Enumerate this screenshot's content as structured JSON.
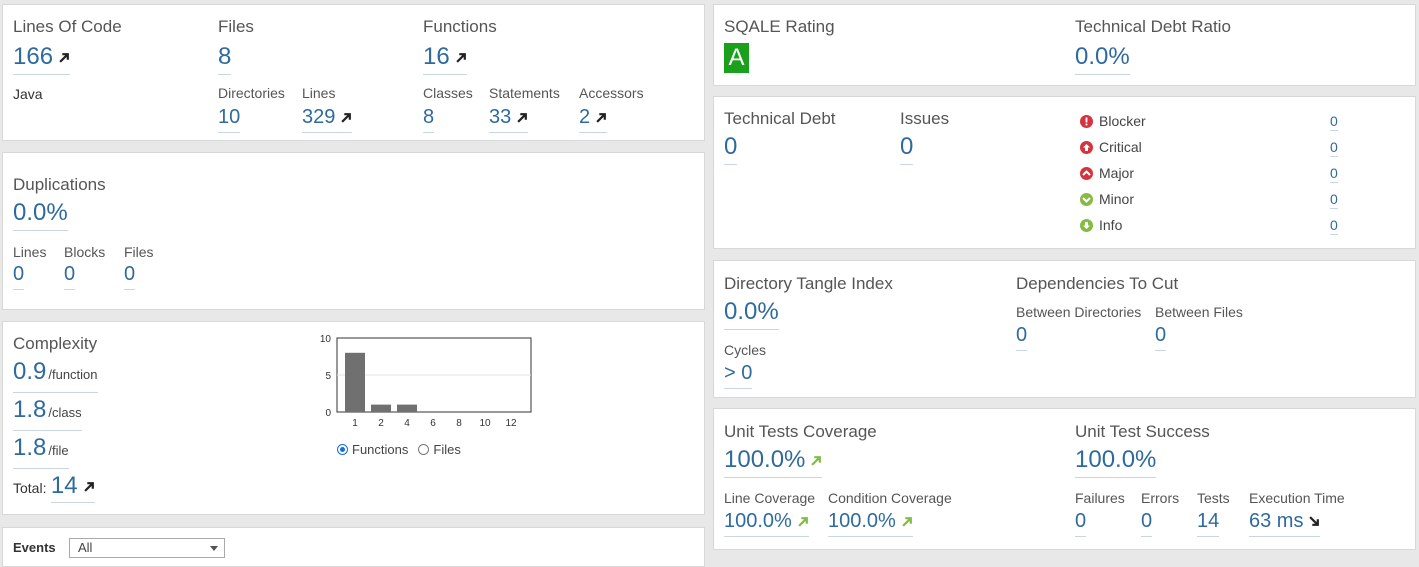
{
  "size": {
    "title": "Lines Of Code",
    "loc": "166",
    "language": "Java",
    "files_label": "Files",
    "files": "8",
    "directories_label": "Directories",
    "directories": "10",
    "lines_label": "Lines",
    "lines": "329",
    "functions_label": "Functions",
    "functions": "16",
    "classes_label": "Classes",
    "classes": "8",
    "statements_label": "Statements",
    "statements": "33",
    "accessors_label": "Accessors",
    "accessors": "2"
  },
  "duplications": {
    "title": "Duplications",
    "density": "0.0%",
    "lines_label": "Lines",
    "lines": "0",
    "blocks_label": "Blocks",
    "blocks": "0",
    "files_label": "Files",
    "files": "0"
  },
  "complexity": {
    "title": "Complexity",
    "per_function": "0.9",
    "per_function_unit": "/function",
    "per_class": "1.8",
    "per_class_unit": "/class",
    "per_file": "1.8",
    "per_file_unit": "/file",
    "total_label": "Total:",
    "total": "14",
    "toggle": {
      "functions_label": "Functions",
      "files_label": "Files",
      "selected": "Functions"
    }
  },
  "chart_data": {
    "type": "bar",
    "categories": [
      "1",
      "2",
      "4",
      "6",
      "8",
      "10",
      "12"
    ],
    "values": [
      8,
      1,
      1,
      0,
      0,
      0,
      0
    ],
    "ylim": [
      0,
      10
    ],
    "yticks": [
      "10",
      "5",
      "0"
    ],
    "bar_color": "#707070"
  },
  "events": {
    "label": "Events",
    "selected": "All"
  },
  "sqale": {
    "title": "SQALE Rating",
    "grade": "A",
    "grade_color": "#1ba01b"
  },
  "debt_ratio": {
    "title": "Technical Debt Ratio",
    "value": "0.0%"
  },
  "debt": {
    "title": "Technical Debt",
    "value": "0",
    "issues_title": "Issues",
    "issues": "0",
    "severities": [
      {
        "name": "Blocker",
        "count": "0",
        "icon": "blocker-icon",
        "color": "#d4333f"
      },
      {
        "name": "Critical",
        "count": "0",
        "icon": "critical-icon",
        "color": "#d4333f"
      },
      {
        "name": "Major",
        "count": "0",
        "icon": "major-icon",
        "color": "#d4333f"
      },
      {
        "name": "Minor",
        "count": "0",
        "icon": "minor-icon",
        "color": "#85bb43"
      },
      {
        "name": "Info",
        "count": "0",
        "icon": "info-icon",
        "color": "#85bb43"
      }
    ]
  },
  "design": {
    "tangle_title": "Directory Tangle Index",
    "tangle": "0.0%",
    "cycles_label": "Cycles",
    "cycles": "> 0",
    "deps_title": "Dependencies To Cut",
    "between_dirs_label": "Between Directories",
    "between_dirs": "0",
    "between_files_label": "Between Files",
    "between_files": "0"
  },
  "coverage": {
    "title": "Unit Tests Coverage",
    "value": "100.0%",
    "line_label": "Line Coverage",
    "line": "100.0%",
    "condition_label": "Condition Coverage",
    "condition": "100.0%"
  },
  "tests": {
    "title": "Unit Test Success",
    "value": "100.0%",
    "failures_label": "Failures",
    "failures": "0",
    "errors_label": "Errors",
    "errors": "0",
    "tests_label": "Tests",
    "tests": "14",
    "time_label": "Execution Time",
    "time": "63 ms"
  },
  "colors": {
    "link": "#2f6a9f",
    "arrow_dark": "#222222",
    "arrow_green": "#85bb43"
  }
}
